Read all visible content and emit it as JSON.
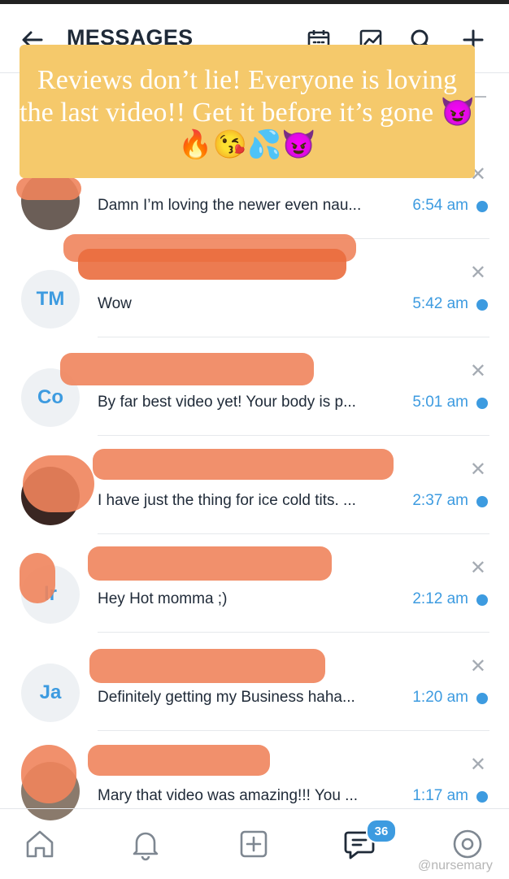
{
  "header": {
    "title": "MESSAGES"
  },
  "banner": {
    "text": "Reviews don’t lie! Everyone is loving the last video!! Get it before it’s gone 😈🔥😘💦😈"
  },
  "messages": [
    {
      "initials": "",
      "preview": "Damn I’m loving the newer even nau...",
      "time": "6:54 am",
      "close": "✕"
    },
    {
      "initials": "TM",
      "preview": "Wow",
      "time": "5:42 am",
      "close": "✕"
    },
    {
      "initials": "Co",
      "preview": "By far best video yet! Your body is p...",
      "time": "5:01 am",
      "close": "✕"
    },
    {
      "initials": "",
      "preview": "I have just the thing for ice cold tits. ...",
      "time": "2:37 am",
      "close": "✕"
    },
    {
      "initials": "lr",
      "preview": "Hey Hot momma ;)",
      "time": "2:12 am",
      "close": "✕"
    },
    {
      "initials": "Ja",
      "preview": "Definitely getting my Business haha...",
      "time": "1:20 am",
      "close": "✕"
    },
    {
      "initials": "",
      "preview": "Mary that video was amazing!!! You ...",
      "time": "1:17 am",
      "close": "✕"
    }
  ],
  "nav": {
    "badge": "36"
  },
  "watermark": "@nursemary",
  "colors": {
    "accent": "#3d9be0",
    "banner": "#f5c96b",
    "redaction": "#f0845c"
  }
}
